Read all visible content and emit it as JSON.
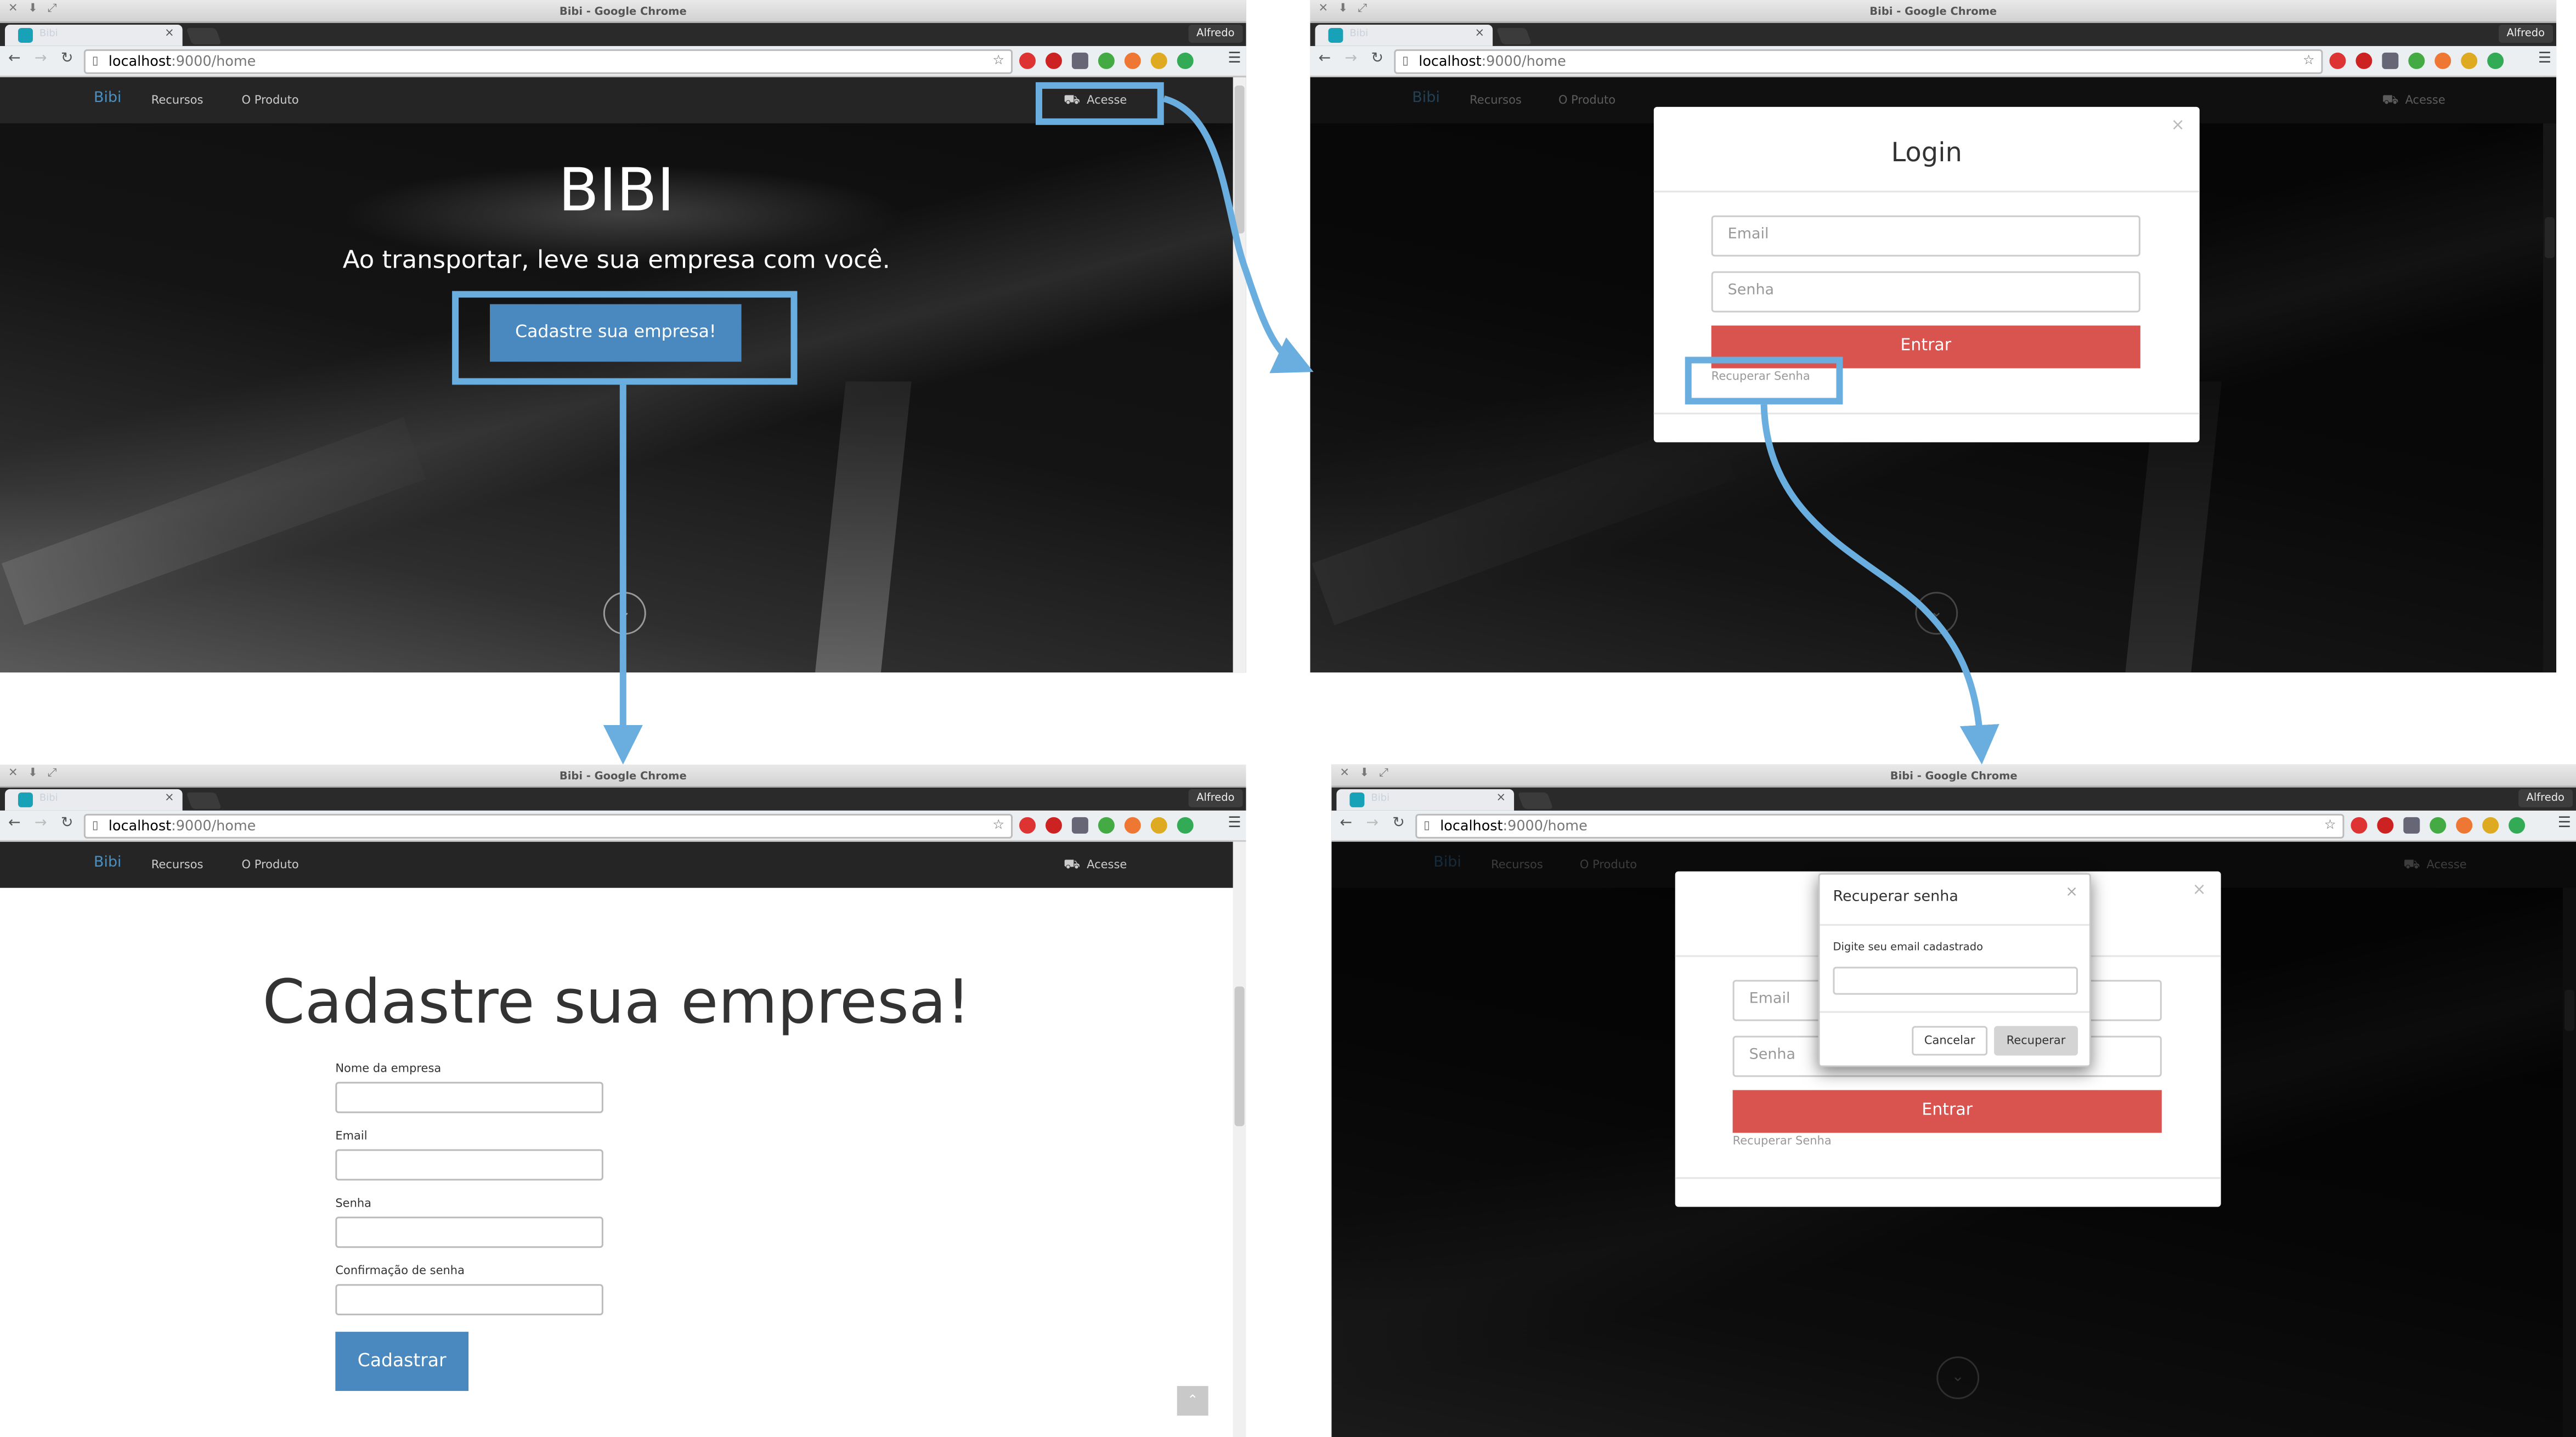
{
  "chrome": {
    "window_title": "Bibi - Google Chrome",
    "tab_title": "Bibi",
    "url_host": "localhost",
    "url_path": ":9000/home",
    "profile": "Alfredo"
  },
  "site": {
    "brand": "Bibi",
    "nav": [
      "Recursos",
      "O Produto"
    ],
    "access": "Acesse"
  },
  "hero": {
    "title": "BIBI",
    "subtitle": "Ao transportar, leve sua empresa com você.",
    "cta": "Cadastre sua empresa!"
  },
  "login_modal": {
    "title": "Login",
    "email_placeholder": "Email",
    "password_placeholder": "Senha",
    "submit": "Entrar",
    "recover_link": "Recuperar Senha",
    "close": "×"
  },
  "recover_modal": {
    "title": "Recuperar senha",
    "label": "Digite seu email cadastrado",
    "cancel": "Cancelar",
    "confirm": "Recuperar",
    "close": "×"
  },
  "signup": {
    "heading": "Cadastre sua empresa!",
    "fields": [
      "Nome da empresa",
      "Email",
      "Senha",
      "Confirmação de senha"
    ],
    "submit": "Cadastrar"
  },
  "colors": {
    "primary_blue": "#4a89c0",
    "danger_red": "#d9534f",
    "highlight": "#6aaee0"
  }
}
